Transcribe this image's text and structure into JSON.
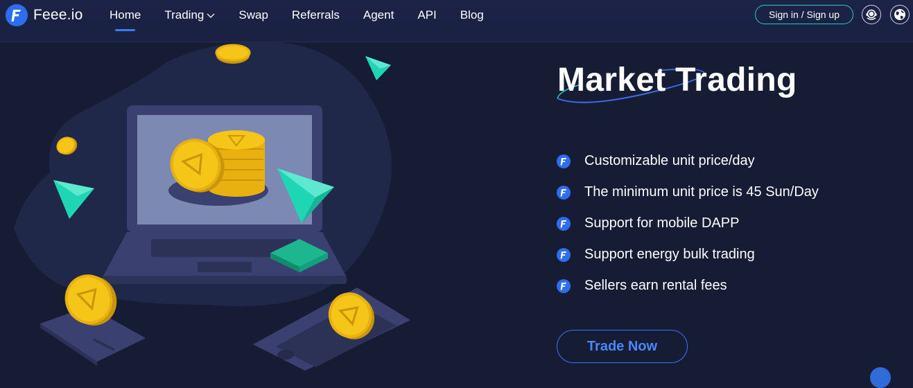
{
  "brand": {
    "name": "Feee.io"
  },
  "nav": {
    "items": [
      {
        "label": "Home",
        "active": true
      },
      {
        "label": "Trading",
        "has_dropdown": true
      },
      {
        "label": "Swap"
      },
      {
        "label": "Referrals"
      },
      {
        "label": "Agent"
      },
      {
        "label": "API"
      },
      {
        "label": "Blog"
      }
    ]
  },
  "header": {
    "signin_label": "Sign in / Sign up",
    "support_icon": "customer-support-icon",
    "language_icon": "globe-icon"
  },
  "hero": {
    "title": "Market Trading",
    "features": [
      "Customizable unit price/day",
      "The minimum unit price is 45 Sun/Day",
      "Support for mobile DAPP",
      "Support energy bulk trading",
      "Sellers earn rental fees"
    ],
    "cta_label": "Trade Now"
  },
  "colors": {
    "background": "#161c34",
    "header": "#1b2347",
    "accent_blue": "#3d7bff",
    "accent_teal": "#2ec9c4",
    "coin_gold": "#f5c518",
    "gem_teal": "#1fd6b4"
  }
}
